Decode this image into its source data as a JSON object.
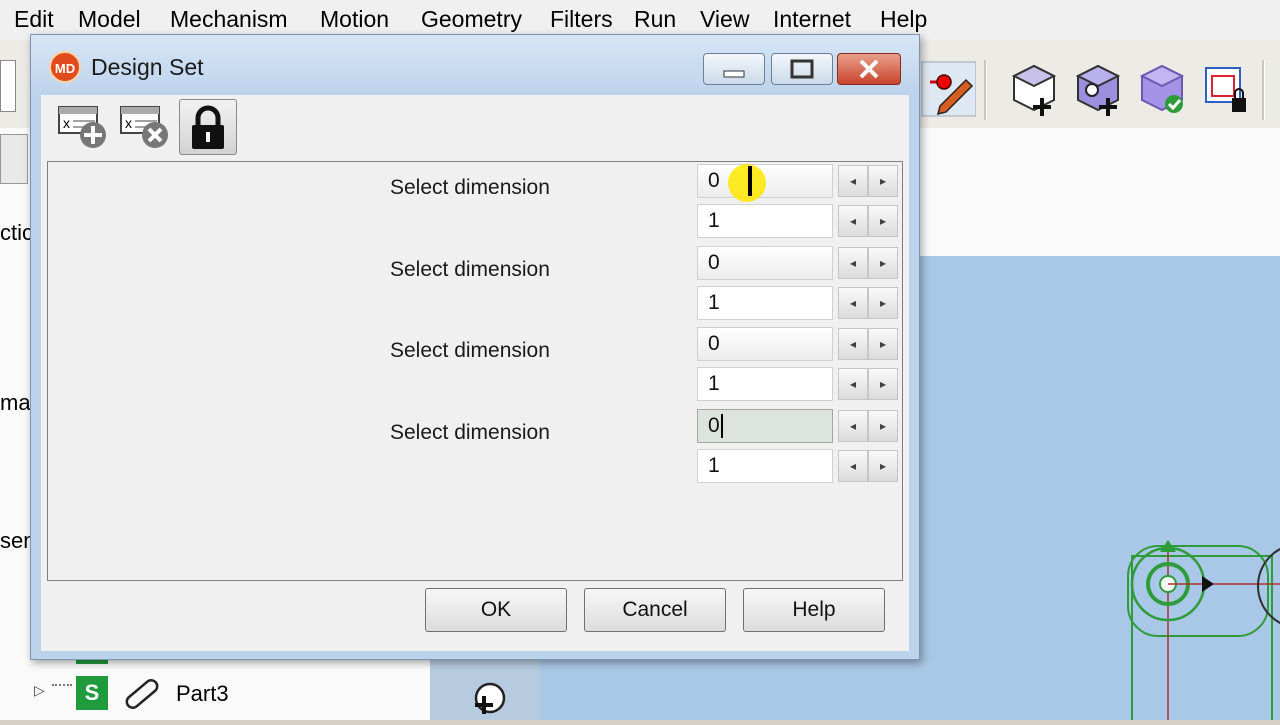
{
  "menu": [
    "Edit",
    "Model",
    "Mechanism",
    "Motion",
    "Geometry",
    "Filters",
    "Run",
    "View",
    "Internet",
    "Help"
  ],
  "left_fragments": [
    "ctic",
    "ma",
    "sem"
  ],
  "tree": {
    "expand_glyph": "▷",
    "item_label": "Part3",
    "badge_letter": "S"
  },
  "dialog": {
    "title": "Design Set",
    "logo": "MD",
    "rows": [
      {
        "label": "Select dimension",
        "min": "0",
        "max": "1"
      },
      {
        "label": "Select dimension",
        "min": "0",
        "max": "1"
      },
      {
        "label": "Select dimension",
        "min": "0",
        "max": "1"
      },
      {
        "label": "Select dimension",
        "min": "0",
        "max": "1"
      }
    ],
    "spin_left": "◂",
    "spin_right": "▸",
    "buttons": {
      "ok": "OK",
      "cancel": "Cancel",
      "help": "Help"
    }
  },
  "icons": {
    "add_set": "table-add-icon",
    "remove_set": "table-remove-icon",
    "lock": "lock-icon"
  },
  "colors": {
    "viewport": "#a9c7e6",
    "dialog_frame": "#bcd3ec",
    "close": "#c9442c",
    "model_green": "#2f9c3a"
  }
}
